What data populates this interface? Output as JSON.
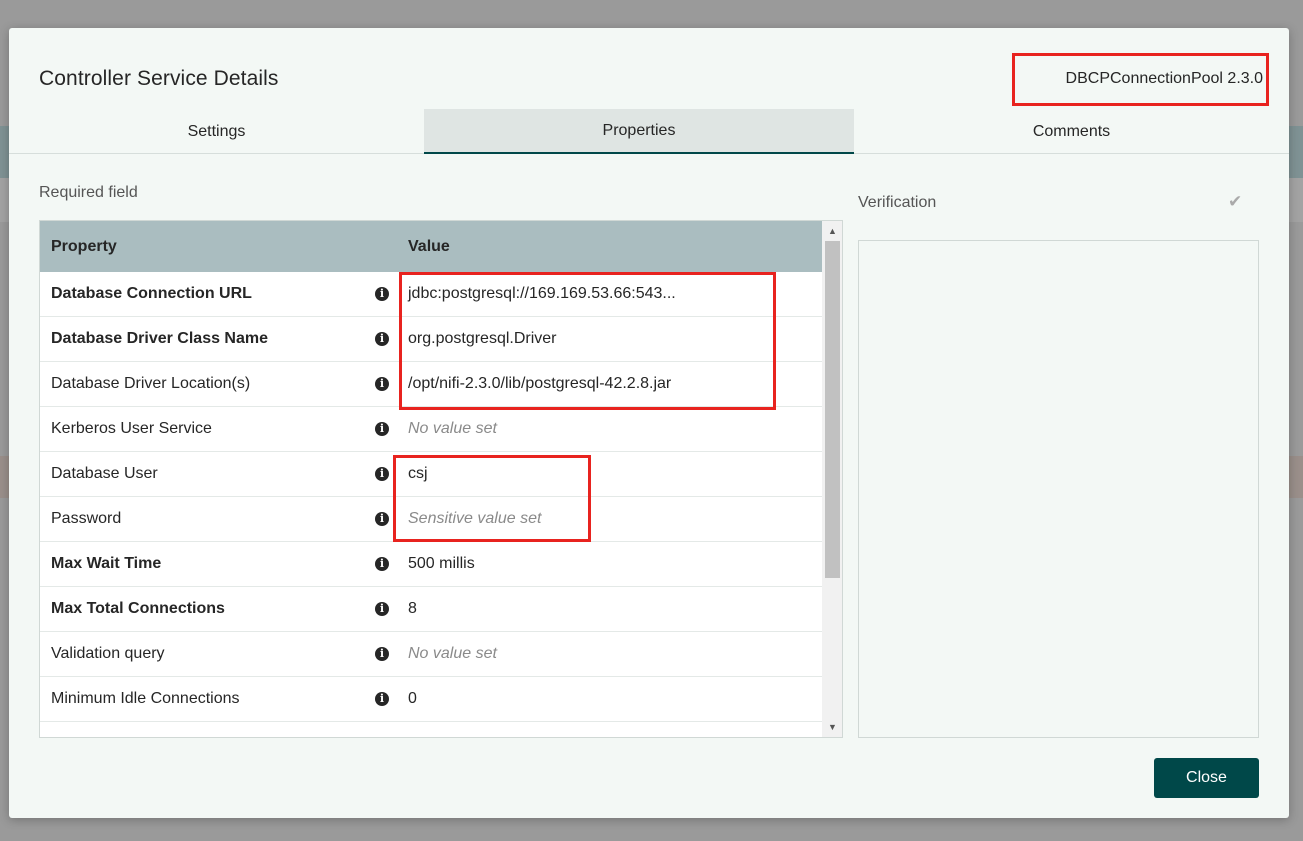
{
  "dialog": {
    "title": "Controller Service Details",
    "service_version": "DBCPConnectionPool 2.3.0",
    "close_label": "Close"
  },
  "tabs": [
    {
      "label": "Settings",
      "selected": false
    },
    {
      "label": "Properties",
      "selected": true
    },
    {
      "label": "Comments",
      "selected": false
    }
  ],
  "properties": {
    "required_label": "Required field",
    "header_property": "Property",
    "header_value": "Value",
    "rows": [
      {
        "name": "Database Connection URL",
        "value": "jdbc:postgresql://169.169.53.66:543...",
        "required": true,
        "placeholder": false,
        "icon": "info-icon"
      },
      {
        "name": "Database Driver Class Name",
        "value": "org.postgresql.Driver",
        "required": true,
        "placeholder": false,
        "icon": "info-icon"
      },
      {
        "name": "Database Driver Location(s)",
        "value": "/opt/nifi-2.3.0/lib/postgresql-42.2.8.jar",
        "required": false,
        "placeholder": false,
        "icon": "info-icon"
      },
      {
        "name": "Kerberos User Service",
        "value": "No value set",
        "required": false,
        "placeholder": true,
        "icon": "info-icon"
      },
      {
        "name": "Database User",
        "value": "csj",
        "required": false,
        "placeholder": false,
        "icon": "info-icon"
      },
      {
        "name": "Password",
        "value": "Sensitive value set",
        "required": false,
        "placeholder": true,
        "icon": "info-icon"
      },
      {
        "name": "Max Wait Time",
        "value": "500 millis",
        "required": true,
        "placeholder": false,
        "icon": "info-icon"
      },
      {
        "name": "Max Total Connections",
        "value": "8",
        "required": true,
        "placeholder": false,
        "icon": "info-icon"
      },
      {
        "name": "Validation query",
        "value": "No value set",
        "required": false,
        "placeholder": true,
        "icon": "info-icon"
      },
      {
        "name": "Minimum Idle Connections",
        "value": "0",
        "required": false,
        "placeholder": false,
        "icon": "info-icon"
      }
    ]
  },
  "verification": {
    "label": "Verification",
    "icon": "check-icon"
  },
  "colors": {
    "accent": "#004849",
    "table_header": "#aabdc0",
    "annotation": "#e8231f"
  }
}
